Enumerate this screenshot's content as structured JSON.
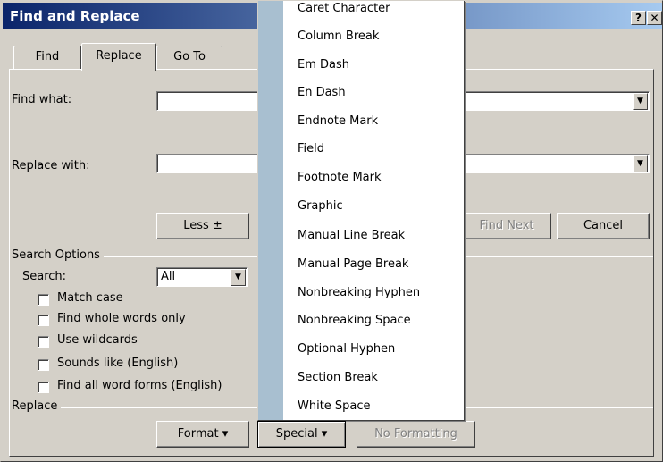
{
  "dialog": {
    "title": "Find and Replace",
    "help_button": "?",
    "close_button": "✕"
  },
  "tabs": [
    {
      "label": "Find",
      "active": false
    },
    {
      "label": "Replace",
      "active": true
    },
    {
      "label": "Go To",
      "active": false
    }
  ],
  "find": {
    "label": "Find what:",
    "value": ""
  },
  "replace": {
    "label": "Replace with:",
    "value": ""
  },
  "buttons": {
    "less": "Less ±",
    "find_next": "Find Next",
    "cancel": "Cancel",
    "format": "Format ▾",
    "special": "Special ▾",
    "no_formatting": "No Formatting"
  },
  "search_options": {
    "group_label": "Search Options",
    "search_label": "Search:",
    "search_value": "All",
    "checkboxes": [
      {
        "label": "Match case",
        "checked": false
      },
      {
        "label": "Find whole words only",
        "checked": false
      },
      {
        "label": "Use wildcards",
        "checked": false
      },
      {
        "label": "Sounds like (English)",
        "checked": false
      },
      {
        "label": "Find all word forms (English)",
        "checked": false
      }
    ]
  },
  "replace_group": {
    "label": "Replace"
  },
  "special_menu": {
    "items": [
      "Caret Character",
      "Column Break",
      "Em Dash",
      "En Dash",
      "Endnote Mark",
      "Field",
      "Footnote Mark",
      "Graphic",
      "Manual Line Break",
      "Manual Page Break",
      "Nonbreaking Hyphen",
      "Nonbreaking Space",
      "Optional Hyphen",
      "Section Break",
      "White Space"
    ]
  },
  "colors": {
    "title_gradient_start": "#0a246a",
    "title_gradient_end": "#a6caf0",
    "dialog_face": "#d4d0c8",
    "menu_gutter": "#a8bfd0"
  }
}
